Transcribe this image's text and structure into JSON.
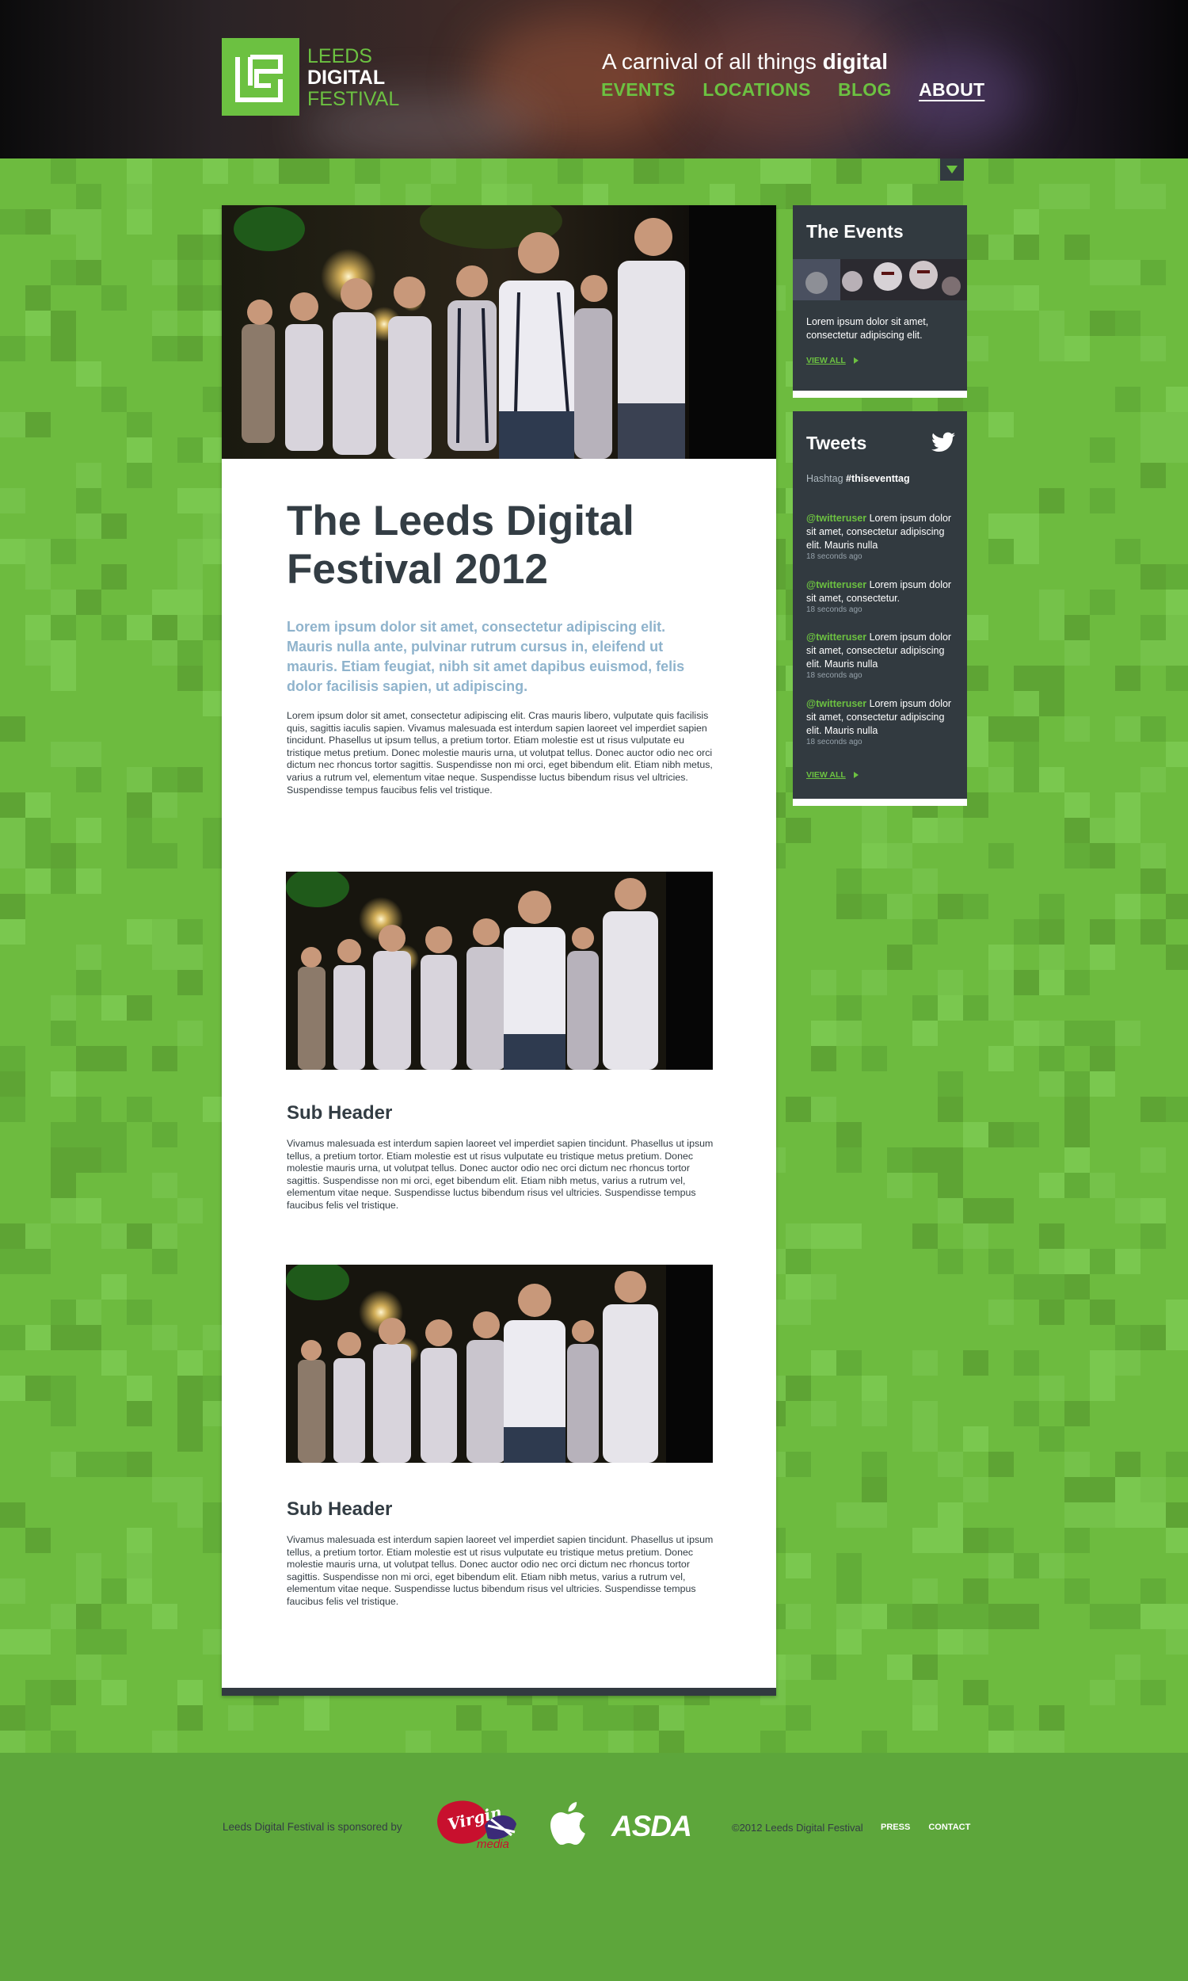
{
  "header": {
    "logo": {
      "line1": "LEEDS",
      "line2": "DIGITAL",
      "line3": "FESTIVAL"
    },
    "tagline": {
      "prefix": "A carnival of all things ",
      "emphasis": "digital"
    },
    "nav": [
      {
        "label": "EVENTS"
      },
      {
        "label": "LOCATIONS"
      },
      {
        "label": "BLOG"
      },
      {
        "label": "ABOUT",
        "active": true
      }
    ]
  },
  "article": {
    "title": "The Leeds Digital Festival 2012",
    "lead": "Lorem ipsum dolor sit amet, consectetur adipiscing elit. Mauris nulla ante, pulvinar rutrum cursus in, eleifend ut mauris. Etiam feugiat, nibh sit amet dapibus euismod, felis dolor facilisis sapien, ut adipiscing.",
    "body": "Lorem ipsum dolor sit amet, consectetur adipiscing elit. Cras mauris libero, vulputate quis facilisis quis, sagittis iaculis sapien. Vivamus malesuada est interdum sapien laoreet vel imperdiet sapien tincidunt. Phasellus ut ipsum tellus, a pretium tortor. Etiam molestie est ut risus vulputate eu tristique metus pretium. Donec molestie mauris urna, ut volutpat tellus. Donec auctor odio nec orci dictum nec rhoncus tortor sagittis. Suspendisse non mi orci, eget bibendum elit. Etiam nibh metus, varius a rutrum vel, elementum vitae neque. Suspendisse luctus bibendum risus vel ultricies. Suspendisse tempus faucibus felis vel tristique.",
    "sections": [
      {
        "heading": "Sub Header",
        "text": "Vivamus malesuada est interdum sapien laoreet vel imperdiet sapien tincidunt. Phasellus ut ipsum tellus, a pretium tortor. Etiam molestie est ut risus vulputate eu tristique metus pretium. Donec molestie mauris urna, ut volutpat tellus. Donec auctor odio nec orci dictum nec rhoncus tortor sagittis. Suspendisse non mi orci, eget bibendum elit. Etiam nibh metus, varius a rutrum vel, elementum vitae neque. Suspendisse luctus bibendum risus vel ultricies. Suspendisse tempus faucibus felis vel tristique."
      },
      {
        "heading": "Sub Header",
        "text": "Vivamus malesuada est interdum sapien laoreet vel imperdiet sapien tincidunt. Phasellus ut ipsum tellus, a pretium tortor. Etiam molestie est ut risus vulputate eu tristique metus pretium. Donec molestie mauris urna, ut volutpat tellus. Donec auctor odio nec orci dictum nec rhoncus tortor sagittis. Suspendisse non mi orci, eget bibendum elit. Etiam nibh metus, varius a rutrum vel, elementum vitae neque. Suspendisse luctus bibendum risus vel ultricies. Suspendisse tempus faucibus felis vel tristique."
      }
    ]
  },
  "sidebar": {
    "events": {
      "title": "The Events",
      "text": "Lorem ipsum dolor sit amet, consectetur adipiscing elit.",
      "view_all": "VIEW ALL"
    },
    "tweets": {
      "title": "Tweets",
      "hashtag_label": "Hashtag",
      "hashtag": "#thiseventtag",
      "items": [
        {
          "user": "@twitteruser",
          "text": "Lorem ipsum dolor sit amet, consectetur adipiscing elit. Mauris nulla",
          "time": "18 seconds ago"
        },
        {
          "user": "@twitteruser",
          "text": "Lorem ipsum dolor sit amet, consectetur.",
          "time": "18 seconds ago"
        },
        {
          "user": "@twitteruser",
          "text": "Lorem ipsum dolor sit amet, consectetur adipiscing elit. Mauris nulla",
          "time": "18 seconds ago"
        },
        {
          "user": "@twitteruser",
          "text": "Lorem ipsum dolor sit amet, consectetur adipiscing elit. Mauris nulla",
          "time": "18 seconds ago"
        }
      ],
      "view_all": "VIEW ALL"
    }
  },
  "footer": {
    "sponsored_by": "Leeds Digital Festival is sponsored by",
    "sponsors": [
      "virgin-media-logo",
      "apple-logo",
      "asda-logo"
    ],
    "asda": "ASDA",
    "copyright": "©2012 Leeds Digital Festival",
    "links": [
      {
        "label": "PRESS"
      },
      {
        "label": "CONTACT"
      }
    ]
  },
  "colors": {
    "brand_green": "#6cc141",
    "page_green": "#6dbb3f",
    "footer_green": "#5da63b",
    "dark_slate": "#323a40",
    "lead_blue": "#8fb3cc"
  },
  "icons": [
    "dropdown-arrow-icon",
    "twitter-bird-icon",
    "play-arrow-icon"
  ]
}
